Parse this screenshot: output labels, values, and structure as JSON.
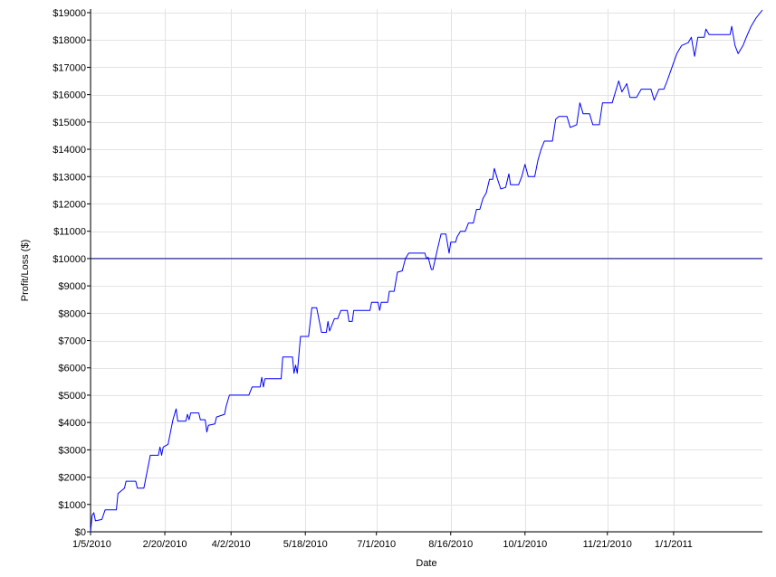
{
  "chart_data": {
    "type": "line",
    "title": "",
    "xlabel": "Date",
    "ylabel": "Profit/Loss ($)",
    "ylim": [
      0,
      19000
    ],
    "yticks": [
      0,
      1000,
      2000,
      3000,
      4000,
      5000,
      6000,
      7000,
      8000,
      9000,
      10000,
      11000,
      12000,
      13000,
      14000,
      15000,
      16000,
      17000,
      18000,
      19000
    ],
    "ytick_labels": [
      "$0",
      "$1000",
      "$2000",
      "$3000",
      "$4000",
      "$5000",
      "$6000",
      "$7000",
      "$8000",
      "$9000",
      "$10000",
      "$11000",
      "$12000",
      "$13000",
      "$14000",
      "$15000",
      "$16000",
      "$17000",
      "$18000",
      "$19000"
    ],
    "xlim": [
      "2010-01-05",
      "2011-02-25"
    ],
    "xticks": [
      "2010-01-05",
      "2010-02-20",
      "2010-04-02",
      "2010-05-18",
      "2010-07-01",
      "2010-08-16",
      "2010-10-01",
      "2010-11-21",
      "2011-01-01"
    ],
    "xtick_labels": [
      "1/5/2010",
      "2/20/2010",
      "4/2/2010",
      "5/18/2010",
      "7/1/2010",
      "8/16/2010",
      "10/1/2010",
      "11/21/2010",
      "1/1/2011"
    ],
    "grid": true,
    "reference_line": {
      "y": 10000,
      "color": "#000080"
    },
    "series": [
      {
        "color": "#0000ff",
        "points": [
          [
            "2010-01-05",
            0
          ],
          [
            "2010-01-06",
            600
          ],
          [
            "2010-01-07",
            700
          ],
          [
            "2010-01-08",
            400
          ],
          [
            "2010-01-12",
            450
          ],
          [
            "2010-01-14",
            800
          ],
          [
            "2010-01-21",
            800
          ],
          [
            "2010-01-22",
            1400
          ],
          [
            "2010-01-26",
            1600
          ],
          [
            "2010-01-27",
            1850
          ],
          [
            "2010-02-02",
            1850
          ],
          [
            "2010-02-03",
            1600
          ],
          [
            "2010-02-07",
            1600
          ],
          [
            "2010-02-11",
            2800
          ],
          [
            "2010-02-16",
            2800
          ],
          [
            "2010-02-17",
            3100
          ],
          [
            "2010-02-18",
            2800
          ],
          [
            "2010-02-19",
            3100
          ],
          [
            "2010-02-22",
            3200
          ],
          [
            "2010-02-24",
            3800
          ],
          [
            "2010-02-25",
            4100
          ],
          [
            "2010-02-27",
            4500
          ],
          [
            "2010-02-28",
            4050
          ],
          [
            "2010-03-05",
            4050
          ],
          [
            "2010-03-06",
            4300
          ],
          [
            "2010-03-07",
            4100
          ],
          [
            "2010-03-08",
            4350
          ],
          [
            "2010-03-13",
            4350
          ],
          [
            "2010-03-14",
            4100
          ],
          [
            "2010-03-17",
            4100
          ],
          [
            "2010-03-18",
            3650
          ],
          [
            "2010-03-19",
            3900
          ],
          [
            "2010-03-23",
            3950
          ],
          [
            "2010-03-24",
            4200
          ],
          [
            "2010-03-29",
            4300
          ],
          [
            "2010-03-30",
            4600
          ],
          [
            "2010-04-01",
            5000
          ],
          [
            "2010-04-13",
            5000
          ],
          [
            "2010-04-15",
            5300
          ],
          [
            "2010-04-20",
            5300
          ],
          [
            "2010-04-21",
            5650
          ],
          [
            "2010-04-22",
            5300
          ],
          [
            "2010-04-23",
            5600
          ],
          [
            "2010-05-03",
            5600
          ],
          [
            "2010-05-04",
            6400
          ],
          [
            "2010-05-10",
            6400
          ],
          [
            "2010-05-11",
            5800
          ],
          [
            "2010-05-12",
            6100
          ],
          [
            "2010-05-13",
            5800
          ],
          [
            "2010-05-15",
            7150
          ],
          [
            "2010-05-20",
            7150
          ],
          [
            "2010-05-22",
            8200
          ],
          [
            "2010-05-25",
            8200
          ],
          [
            "2010-05-28",
            7300
          ],
          [
            "2010-05-31",
            7300
          ],
          [
            "2010-06-01",
            7700
          ],
          [
            "2010-06-02",
            7350
          ],
          [
            "2010-06-05",
            7800
          ],
          [
            "2010-06-07",
            7800
          ],
          [
            "2010-06-09",
            8100
          ],
          [
            "2010-06-13",
            8100
          ],
          [
            "2010-06-14",
            7700
          ],
          [
            "2010-06-16",
            7700
          ],
          [
            "2010-06-17",
            8100
          ],
          [
            "2010-06-27",
            8100
          ],
          [
            "2010-06-28",
            8400
          ],
          [
            "2010-07-02",
            8400
          ],
          [
            "2010-07-03",
            8100
          ],
          [
            "2010-07-04",
            8400
          ],
          [
            "2010-07-08",
            8400
          ],
          [
            "2010-07-09",
            8800
          ],
          [
            "2010-07-12",
            8800
          ],
          [
            "2010-07-14",
            9500
          ],
          [
            "2010-07-17",
            9550
          ],
          [
            "2010-07-19",
            10000
          ],
          [
            "2010-07-21",
            10200
          ],
          [
            "2010-07-31",
            10200
          ],
          [
            "2010-08-01",
            10000
          ],
          [
            "2010-08-02",
            10050
          ],
          [
            "2010-08-04",
            9600
          ],
          [
            "2010-08-05",
            9600
          ],
          [
            "2010-08-08",
            10400
          ],
          [
            "2010-08-10",
            10900
          ],
          [
            "2010-08-13",
            10900
          ],
          [
            "2010-08-15",
            10200
          ],
          [
            "2010-08-16",
            10600
          ],
          [
            "2010-08-19",
            10600
          ],
          [
            "2010-08-20",
            10800
          ],
          [
            "2010-08-22",
            11000
          ],
          [
            "2010-08-25",
            11000
          ],
          [
            "2010-08-27",
            11300
          ],
          [
            "2010-08-30",
            11300
          ],
          [
            "2010-09-01",
            11800
          ],
          [
            "2010-09-03",
            11800
          ],
          [
            "2010-09-05",
            12200
          ],
          [
            "2010-09-07",
            12400
          ],
          [
            "2010-09-09",
            12900
          ],
          [
            "2010-09-11",
            12900
          ],
          [
            "2010-09-12",
            13300
          ],
          [
            "2010-09-14",
            12900
          ],
          [
            "2010-09-16",
            12550
          ],
          [
            "2010-09-19",
            12600
          ],
          [
            "2010-09-21",
            13100
          ],
          [
            "2010-09-22",
            12700
          ],
          [
            "2010-09-27",
            12700
          ],
          [
            "2010-09-29",
            13000
          ],
          [
            "2010-10-01",
            13450
          ],
          [
            "2010-10-03",
            13000
          ],
          [
            "2010-10-07",
            13000
          ],
          [
            "2010-10-09",
            13600
          ],
          [
            "2010-10-11",
            14000
          ],
          [
            "2010-10-13",
            14300
          ],
          [
            "2010-10-18",
            14300
          ],
          [
            "2010-10-20",
            15100
          ],
          [
            "2010-10-22",
            15200
          ],
          [
            "2010-10-27",
            15200
          ],
          [
            "2010-10-29",
            14800
          ],
          [
            "2010-11-02",
            14900
          ],
          [
            "2010-11-04",
            15700
          ],
          [
            "2010-11-06",
            15300
          ],
          [
            "2010-11-10",
            15300
          ],
          [
            "2010-11-12",
            14900
          ],
          [
            "2010-11-16",
            14900
          ],
          [
            "2010-11-18",
            15700
          ],
          [
            "2010-11-24",
            15700
          ],
          [
            "2010-11-28",
            16500
          ],
          [
            "2010-11-30",
            16100
          ],
          [
            "2010-12-03",
            16400
          ],
          [
            "2010-12-05",
            15900
          ],
          [
            "2010-12-09",
            15900
          ],
          [
            "2010-12-12",
            16200
          ],
          [
            "2010-12-18",
            16200
          ],
          [
            "2010-12-20",
            15800
          ],
          [
            "2010-12-23",
            16200
          ],
          [
            "2010-12-26",
            16200
          ],
          [
            "2010-12-28",
            16500
          ],
          [
            "2010-12-31",
            17000
          ],
          [
            "2011-01-03",
            17500
          ],
          [
            "2011-01-06",
            17800
          ],
          [
            "2011-01-10",
            17900
          ],
          [
            "2011-01-12",
            18100
          ],
          [
            "2011-01-14",
            17400
          ],
          [
            "2011-01-16",
            18100
          ],
          [
            "2011-01-20",
            18100
          ],
          [
            "2011-01-21",
            18400
          ],
          [
            "2011-01-23",
            18200
          ],
          [
            "2011-02-05",
            18200
          ],
          [
            "2011-02-06",
            18500
          ],
          [
            "2011-02-08",
            17800
          ],
          [
            "2011-02-10",
            17500
          ],
          [
            "2011-02-13",
            17800
          ],
          [
            "2011-02-15",
            18100
          ],
          [
            "2011-02-18",
            18500
          ],
          [
            "2011-02-21",
            18800
          ],
          [
            "2011-02-25",
            19100
          ]
        ]
      }
    ]
  }
}
